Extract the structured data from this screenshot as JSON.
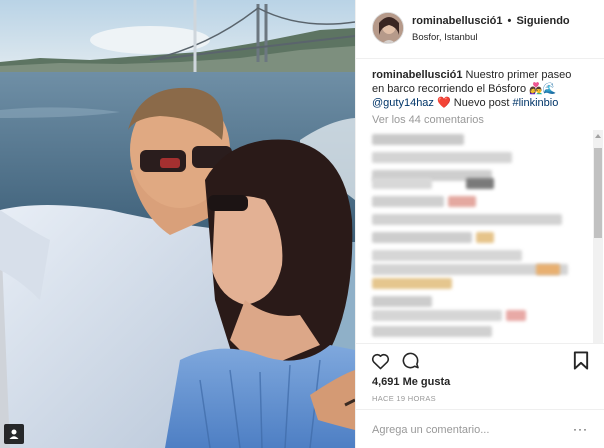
{
  "header": {
    "username": "rominabellusció1",
    "separator": "•",
    "follow_status": "Siguiendo",
    "location": "Bosfor, Istanbul"
  },
  "caption": {
    "username": "rominabellusció1",
    "text": "Nuestro primer paseo en barco recorriendo el Bósforo",
    "emoji": "👩‍❤️‍👨🌊",
    "mention": "@guty14haz",
    "heart": "❤️",
    "text2": "Nuevo post",
    "hashtag": "#linkinbio"
  },
  "view_all_comments": "Ver los 44 comentarios",
  "actions": {
    "like_icon": "heart-outline-icon",
    "comment_icon": "speech-bubble-icon",
    "save_icon": "bookmark-icon"
  },
  "likes": "4,691 Me gusta",
  "timestamp": "HACE 19 HORAS",
  "add_comment_placeholder": "Agrega un comentario...",
  "more_options": "···",
  "colors": {
    "link": "#003569",
    "muted": "#999999",
    "border": "#efefef",
    "heart": "#ed4956"
  }
}
